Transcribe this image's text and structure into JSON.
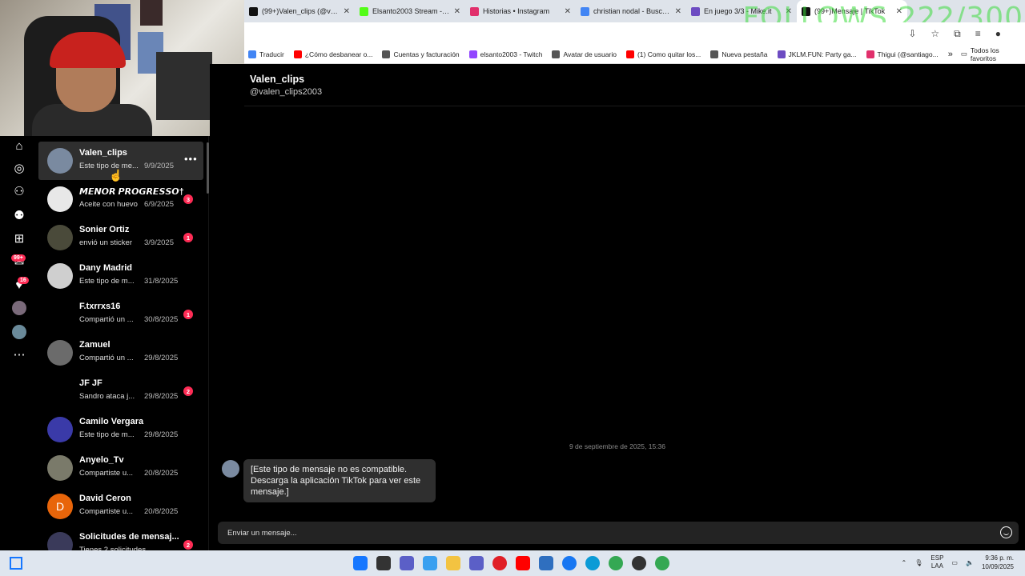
{
  "browser": {
    "tabs": [
      {
        "title": "(99+)Valen_clips (@valen_",
        "color": "#111111",
        "active": false
      },
      {
        "title": "Elsanto2003 Stream - Wat",
        "color": "#53fc18",
        "active": false
      },
      {
        "title": "Historias • Instagram",
        "color": "#e1306c",
        "active": false
      },
      {
        "title": "christian nodal - Buscar c",
        "color": "#4285f4",
        "active": false
      },
      {
        "title": "En juego 3/3 - Mike.it",
        "color": "#6d4cc2",
        "active": false
      },
      {
        "title": "(99+)Mensaje | TikTok",
        "color": "#111111",
        "active": true
      }
    ],
    "overlay_text": "FOLLOWS 222/300",
    "bookmarks": [
      {
        "label": "Traducir",
        "color": "#4285f4"
      },
      {
        "label": "¿Cómo desbanear o...",
        "color": "#ff0000"
      },
      {
        "label": "Cuentas y facturación",
        "color": "#555555"
      },
      {
        "label": "elsanto2003 - Twitch",
        "color": "#9146ff"
      },
      {
        "label": "Avatar de usuario",
        "color": "#555555"
      },
      {
        "label": "(1) Como quitar los...",
        "color": "#ff0000"
      },
      {
        "label": "Nueva pestaña",
        "color": "#555555"
      },
      {
        "label": "JKLM.FUN: Party ga...",
        "color": "#6d4cc2"
      },
      {
        "label": "Thigui (@santiago...",
        "color": "#e1306c"
      }
    ],
    "bookmarks_all": "Todos los favoritos"
  },
  "rail": {
    "messages_badge": "99+",
    "activity_badge": "16"
  },
  "conversations": [
    {
      "name": "Valen_clips",
      "preview": "Este tipo de me...",
      "date": "9/9/2025",
      "badge": "",
      "avatar_color": "#7a8aa0",
      "active": true
    },
    {
      "name": "𝙈𝙀𝙉𝙊𝙍 𝙋𝙍𝙊𝙂𝙍𝙀𝙎𝙎𝙊†",
      "preview": "Aceite con huevo",
      "date": "6/9/2025",
      "badge": "3",
      "avatar_color": "#e8e8e8",
      "active": false
    },
    {
      "name": "Sonier Ortiz",
      "preview": "envió un sticker",
      "date": "3/9/2025",
      "badge": "1",
      "avatar_color": "#4a4a3a",
      "active": false
    },
    {
      "name": "Dany Madrid",
      "preview": "Este tipo de m...",
      "date": "31/8/2025",
      "badge": "",
      "avatar_color": "#cfcfcf",
      "active": false
    },
    {
      "name": "F.txrrxs16",
      "preview": "Compartió un ...",
      "date": "30/8/2025",
      "badge": "1",
      "avatar_color": "#000000",
      "active": false
    },
    {
      "name": "Zamuel",
      "preview": "Compartió un ...",
      "date": "29/8/2025",
      "badge": "",
      "avatar_color": "#6b6b6b",
      "active": false
    },
    {
      "name": "JF JF",
      "preview": "Sandro ataca j...",
      "date": "29/8/2025",
      "badge": "2",
      "avatar_color": "#000000",
      "active": false
    },
    {
      "name": "Camilo Vergara",
      "preview": "Este tipo de m...",
      "date": "29/8/2025",
      "badge": "",
      "avatar_color": "#3a3aa8",
      "active": false
    },
    {
      "name": "Anyelo_Tv",
      "preview": "Compartiste u...",
      "date": "20/8/2025",
      "badge": "",
      "avatar_color": "#7a7a6a",
      "active": false
    },
    {
      "name": "David Ceron",
      "preview": "Compartiste u...",
      "date": "20/8/2025",
      "badge": "",
      "avatar_color": "#e8650a",
      "avatar_letter": "D",
      "active": false
    },
    {
      "name": "Solicitudes de mensaj...",
      "preview": "Tienes 2 solicitudes",
      "date": "",
      "badge": "2",
      "avatar_color": "#3a3a5a",
      "active": false
    }
  ],
  "chat": {
    "name": "Valen_clips",
    "handle": "@valen_clips2003",
    "timestamp": "9 de septiembre de 2025, 15:36",
    "message": "[Este tipo de mensaje no es compatible. Descarga la aplicación TikTok para ver este mensaje.]",
    "composer_placeholder": "Enviar un mensaje..."
  },
  "taskbar": {
    "lang_top": "ESP",
    "lang_bottom": "LAA",
    "time": "9:36 p. m.",
    "date": "10/09/2025"
  }
}
